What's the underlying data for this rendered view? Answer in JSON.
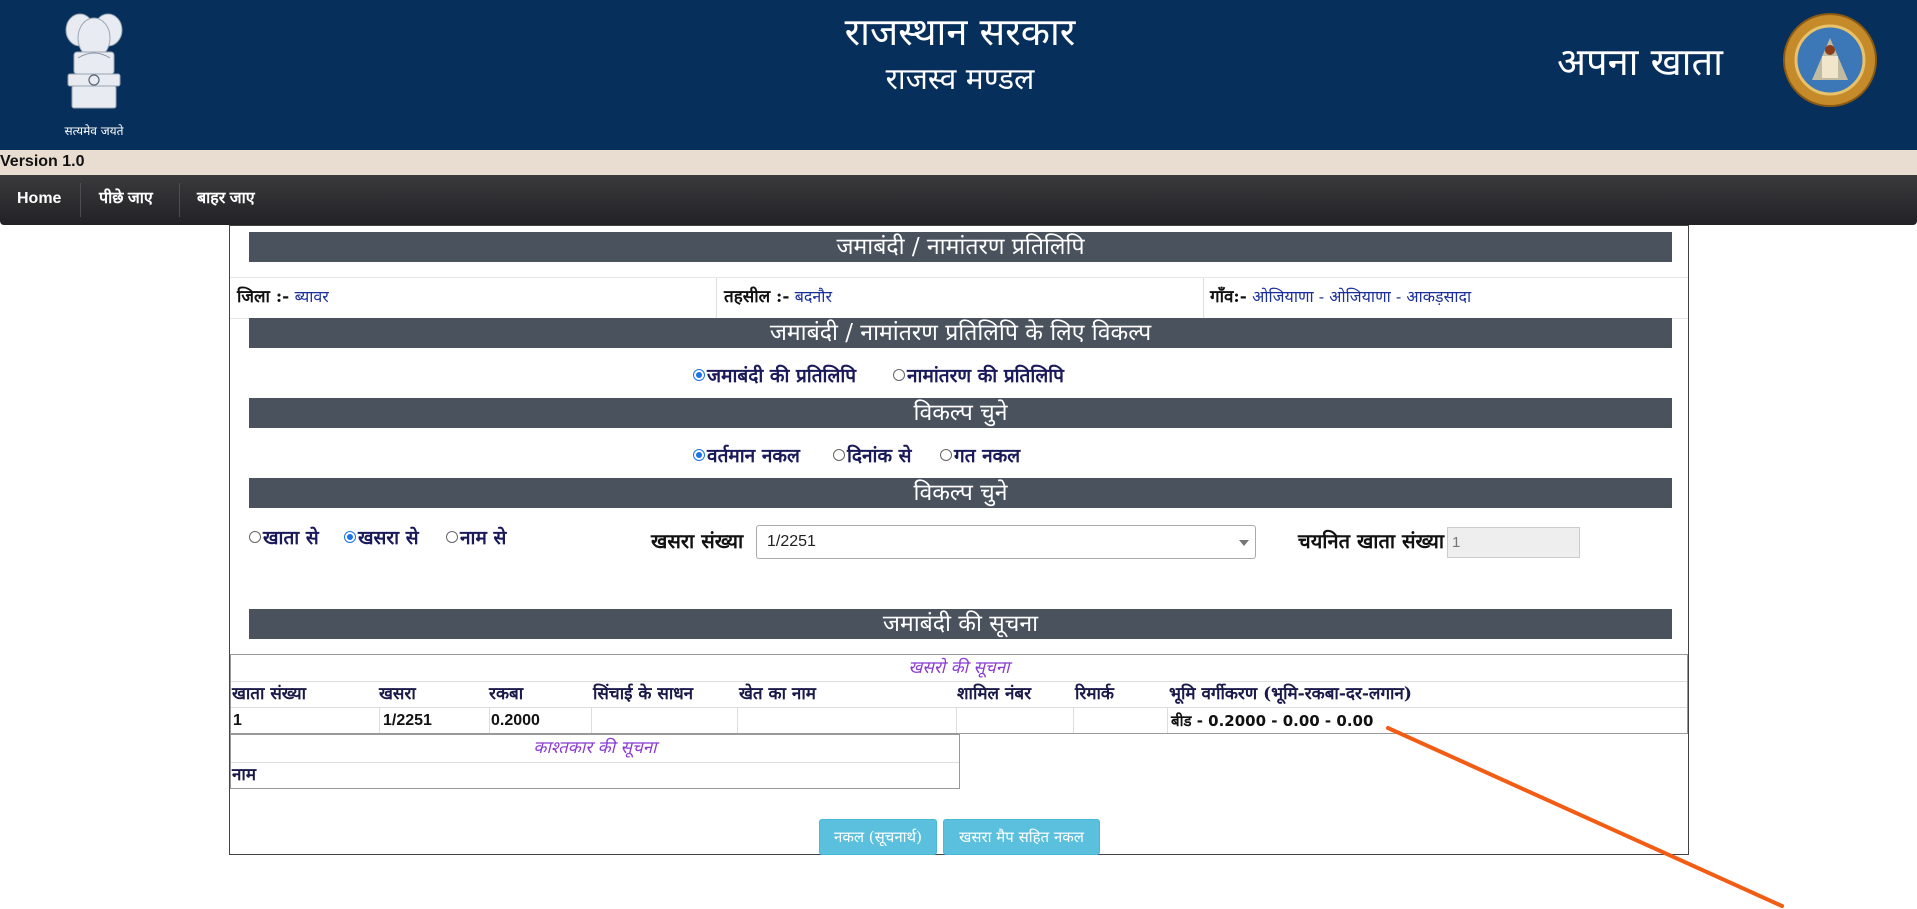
{
  "header": {
    "emblem_motto": "सत्यमेव जयते",
    "title": "राजस्थान सरकार",
    "subtitle": "राजस्व मण्डल",
    "app_name": "अपना खाता",
    "bg_color": "#072f5c"
  },
  "version": "Version 1.0",
  "nav": {
    "home": "Home",
    "back": "पीछे जाए",
    "exit": "बाहर जाए"
  },
  "main": {
    "heading": "जमाबंदी / नामांतरण प्रतिलिपि",
    "location": {
      "district_label": "जिला :-",
      "district_value": "ब्यावर",
      "tehsil_label": "तहसील :-",
      "tehsil_value": "बदनौर",
      "village_label": "गाँव:-",
      "village_value": "ओजियाणा - ओजियाणा - आकड़सादा"
    },
    "options_heading": "जमाबंदी / नामांतरण प्रतिलिपि के लिए विकल्प",
    "copy_type": {
      "jamabandi": "जमाबंदी की प्रतिलिपि",
      "namantaran": "नामांतरण की प्रतिलिपि",
      "selected": "jamabandi"
    },
    "choose_heading_1": "विकल्प चुने",
    "date_options": {
      "current": "वर्तमान नकल",
      "by_date": "दिनांक से",
      "past": "गत नकल",
      "selected": "current"
    },
    "choose_heading_2": "विकल्प चुने",
    "search_by": {
      "khata": "खाता से",
      "khasra": "खसरा से",
      "name": "नाम से",
      "selected": "khasra"
    },
    "khasra_label": "खसरा संख्या",
    "khasra_value": "1/2251",
    "selected_khata_label": "चयनित खाता संख्या",
    "selected_khata_placeholder": "1",
    "info_heading": "जमाबंदी की सूचना",
    "khasra_table": {
      "caption": "खसरो की सूचना",
      "columns": [
        "खाता संख्या",
        "खसरा",
        "रकबा",
        "सिंचाई के साधन",
        "खेत का नाम",
        "शामिल नंबर",
        "रिमार्क",
        "भूमि वर्गीकरण (भूमि-रकबा-दर-लगान)"
      ],
      "rows": [
        [
          "1",
          "1/2251",
          "0.2000",
          "",
          "",
          "",
          "",
          "बीड - 0.2000 - 0.00 - 0.00"
        ]
      ]
    },
    "cultivator_table": {
      "caption": "काश्तकार की सूचना",
      "columns": [
        "नाम"
      ]
    },
    "buttons": {
      "copy_info": "नकल (सूचनार्थ)",
      "copy_with_map": "खसरा मैप सहित नकल"
    }
  },
  "annotation_color": "#f25c13"
}
